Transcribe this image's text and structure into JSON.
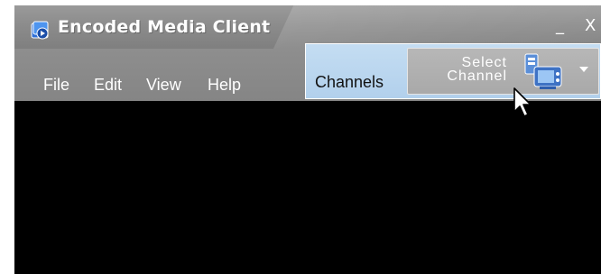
{
  "window": {
    "title": "Encoded Media Client",
    "controls": {
      "minimize": "_",
      "close": "X"
    }
  },
  "menu": {
    "items": [
      "File",
      "Edit",
      "View",
      "Help"
    ]
  },
  "channels": {
    "label": "Channels",
    "select_button": {
      "line1": "Select",
      "line2": "Channel"
    }
  },
  "colors": {
    "titlebar": "#8c8c8c",
    "channels_panel": "#b9d5ee",
    "content_bg": "#000000"
  },
  "icons": {
    "app": "media-client-icon",
    "channel": "tv-channel-icon",
    "dropdown": "chevron-down-icon",
    "pointer": "mouse-pointer-icon"
  }
}
